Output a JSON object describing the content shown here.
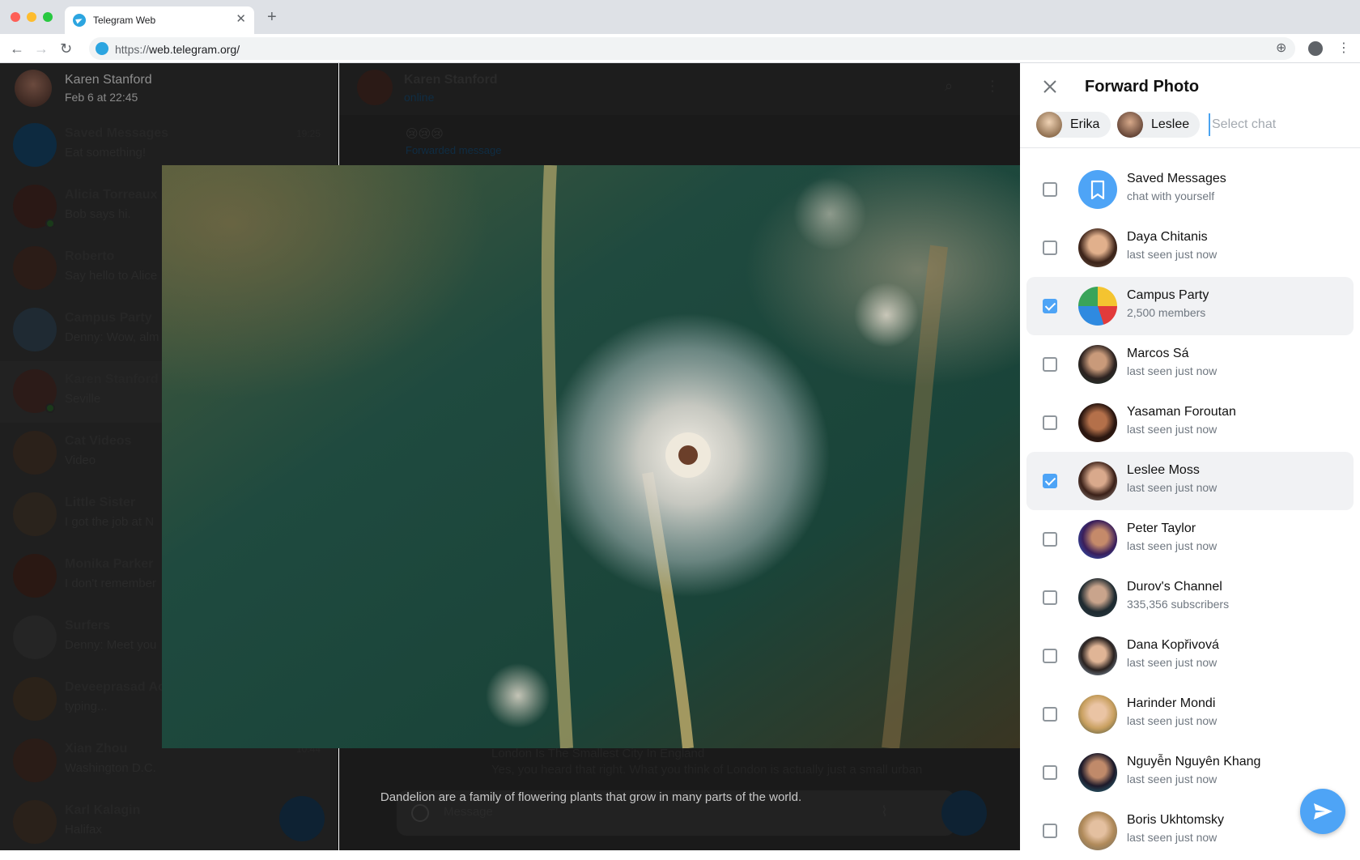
{
  "browser": {
    "tab_title": "Telegram Web",
    "url_scheme": "https://",
    "url_host": "web.telegram.org/"
  },
  "sidebar": {
    "header": {
      "name": "Karen Stanford",
      "sub": "Feb 6 at 22:45"
    },
    "chats": [
      {
        "name": "Saved Messages",
        "sub": "Eat something!",
        "time": "19:25"
      },
      {
        "name": "Alicia Torreaux",
        "sub": "Bob says hi.",
        "time": ""
      },
      {
        "name": "Roberto",
        "sub": "Say hello to Alice",
        "time": ""
      },
      {
        "name": "Campus Party",
        "sub": "Denny: Wow, alm",
        "time": ""
      },
      {
        "name": "Karen Stanford",
        "sub": "Seville",
        "time": ""
      },
      {
        "name": "Cat Videos",
        "sub": "Video",
        "time": ""
      },
      {
        "name": "Little Sister",
        "sub": "I got the job at N",
        "time": ""
      },
      {
        "name": "Monika Parker",
        "sub": "I don't remember",
        "time": ""
      },
      {
        "name": "Surfers",
        "sub": "Denny: Meet you",
        "time": ""
      },
      {
        "name": "Deveeprasad Ach",
        "sub": "typing...",
        "time": ""
      },
      {
        "name": "Xian Zhou",
        "sub": "Washington D.C.",
        "time": "10:44"
      },
      {
        "name": "Karl Kalagin",
        "sub": "Halifax",
        "time": ""
      }
    ]
  },
  "chat": {
    "name": "Karen Stanford",
    "status": "online",
    "emoji": "😢😢😢",
    "forwarded": "Forwarded message",
    "preview_title": "London Is The Smallest City In England",
    "preview_text": "Yes, you heard that right. What you think of London is actually just a small urban",
    "message_placeholder": "Message"
  },
  "viewer": {
    "caption": "Dandelion are a family of flowering plants that grow in many parts of the world."
  },
  "forward": {
    "title": "Forward Photo",
    "chips": [
      "Erika",
      "Leslee"
    ],
    "search_placeholder": "Select chat",
    "rows": [
      {
        "name": "Saved Messages",
        "sub": "chat with yourself",
        "checked": false
      },
      {
        "name": "Daya Chitanis",
        "sub": "last seen just now",
        "checked": false
      },
      {
        "name": "Campus Party",
        "sub": "2,500 members",
        "checked": true
      },
      {
        "name": "Marcos Sá",
        "sub": "last seen just now",
        "checked": false
      },
      {
        "name": "Yasaman Foroutan",
        "sub": "last seen just now",
        "checked": false
      },
      {
        "name": "Leslee Moss",
        "sub": "last seen just now",
        "checked": true
      },
      {
        "name": "Peter Taylor",
        "sub": "last seen just now",
        "checked": false
      },
      {
        "name": "Durov's Channel",
        "sub": "335,356 subscribers",
        "checked": false
      },
      {
        "name": "Dana Kopřivová",
        "sub": "last seen just now",
        "checked": false
      },
      {
        "name": "Harinder Mondi",
        "sub": "last seen just now",
        "checked": false
      },
      {
        "name": "Nguyễn Nguyên Khang",
        "sub": "last seen just now",
        "checked": false
      },
      {
        "name": "Boris Ukhtomsky",
        "sub": "last seen just now",
        "checked": false
      }
    ]
  },
  "colors": {
    "accent": "#4ea4f6",
    "telegram": "#2ca5e0"
  }
}
